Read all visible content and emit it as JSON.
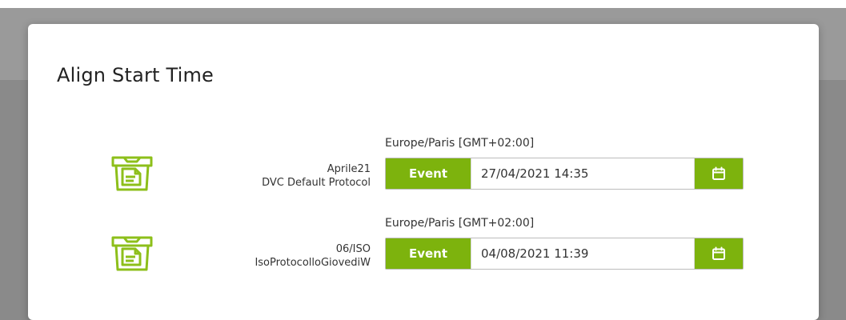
{
  "dialog": {
    "title": "Align Start Time",
    "accent_color": "#7db30d",
    "rows": [
      {
        "icon": "storage-box-icon",
        "name": "Aprile21",
        "protocol": "DVC Default Protocol",
        "timezone": "Europe/Paris [GMT+02:00]",
        "mode_label": "Event",
        "datetime": "27/04/2021 14:35",
        "calendar_icon": "calendar-icon"
      },
      {
        "icon": "storage-box-icon",
        "name": "06/ISO",
        "protocol": "IsoProtocolloGiovediW",
        "timezone": "Europe/Paris [GMT+02:00]",
        "mode_label": "Event",
        "datetime": "04/08/2021 11:39",
        "calendar_icon": "calendar-icon"
      }
    ]
  }
}
